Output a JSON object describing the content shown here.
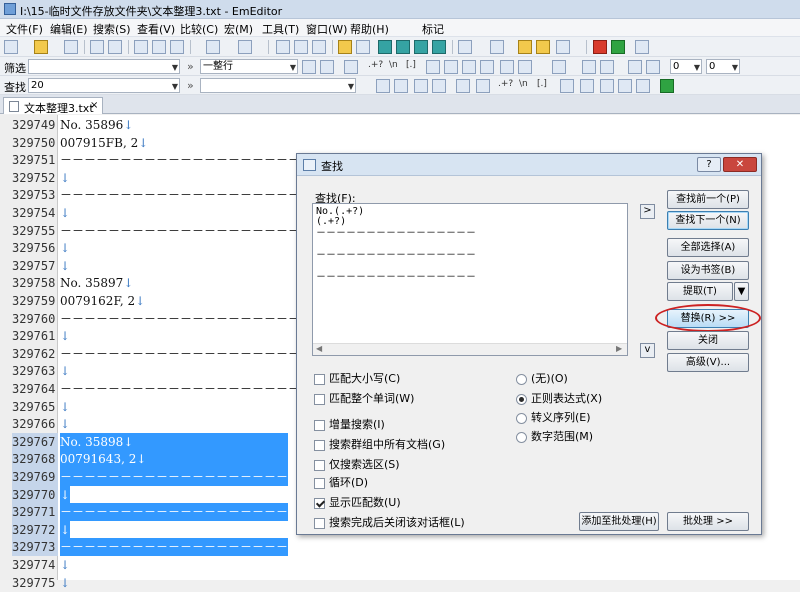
{
  "window": {
    "title": "I:\\15-临时文件存放文件夹\\文本整理3.txt - EmEditor"
  },
  "menu": [
    "文件(F)",
    "编辑(E)",
    "搜索(S)",
    "查看(V)",
    "比较(C)",
    "宏(M)",
    "工具(T)",
    "窗口(W)",
    "帮助(H)",
    "标记"
  ],
  "filter_bar": {
    "label": "筛选",
    "mode_value": "一整行",
    "spin1": "0",
    "spin2": "0",
    "regex_label": ".+?",
    "newline_label": "\\n",
    "bracket_label": "[.]"
  },
  "find_bar": {
    "label": "查找",
    "value": "20",
    "regex_label": ".+?",
    "newline_label": "\\n",
    "bracket_label": "[.]"
  },
  "tab": {
    "label": "文本整理3.txt",
    "close": "×"
  },
  "editor": {
    "line_numbers": [
      "329749",
      "329750",
      "329751",
      "329752",
      "329753",
      "329754",
      "329755",
      "329756",
      "329757",
      "329758",
      "329759",
      "329760",
      "329761",
      "329762",
      "329763",
      "329764",
      "329765",
      "329766",
      "329767",
      "329768",
      "329769",
      "329770",
      "329771",
      "329772",
      "329773",
      "329774",
      "329775"
    ],
    "lines": [
      "No. 35896",
      "007915FB, 2",
      "－－－－－－－－－－－－－－－－－－－－",
      "",
      "－－－－－－－－－－－－－－－－－－－－",
      "",
      "－－－－－－－－－－－－－－－－－－－－",
      "",
      "",
      "No. 35897",
      "0079162F, 2",
      "－－－－－－－－－－－－－－－－－－－－",
      "",
      "－－－－－－－－－－－－－－－－－－－－",
      "",
      "－－－－－－－－－－－－－－－－－－－－",
      "",
      "",
      "No. 35898",
      "00791643, 2",
      "－－－－－－－－－－－－－－－－－－－－",
      "",
      "－－－－－－－－－－－－－－－－－－－－",
      "",
      "－－－－－－－－－－－－－－－－－－－－",
      "",
      ""
    ],
    "newline_mark": "↓"
  },
  "dialog": {
    "title": "查找",
    "help_button": "?",
    "close_button": "✕",
    "find_label": "查找(F):",
    "find_lines": [
      "No.(.+?)",
      "(.+?)",
      "－－－－－－－－－－－－－－－－",
      "",
      "－－－－－－－－－－－－－－－－",
      "",
      "－－－－－－－－－－－－－－－－"
    ],
    "arrow_right": ">",
    "arrow_down": "v",
    "buttons": {
      "find_prev": "查找前一个(P)",
      "find_next": "查找下一个(N)",
      "select_all": "全部选择(A)",
      "bookmark": "设为书签(B)",
      "extract": "提取(T)",
      "extract_arrow": "▼",
      "replace": "替换(R) >>",
      "close": "关闭",
      "advanced": "高级(V)...",
      "add_batch": "添加至批处理(H)",
      "batch": "批处理 >>"
    },
    "checkboxes": [
      {
        "label": "匹配大小写(C)",
        "checked": false
      },
      {
        "label": "匹配整个单词(W)",
        "checked": false
      },
      {
        "label": "增量搜索(I)",
        "checked": false
      },
      {
        "label": "搜索群组中所有文档(G)",
        "checked": false
      },
      {
        "label": "仅搜索选区(S)",
        "checked": false
      },
      {
        "label": "循环(D)",
        "checked": false
      },
      {
        "label": "显示匹配数(U)",
        "checked": true
      },
      {
        "label": "搜索完成后关闭该对话框(L)",
        "checked": false
      }
    ],
    "radios": [
      {
        "label": "(无)(O)",
        "checked": false
      },
      {
        "label": "正则表达式(X)",
        "checked": true
      },
      {
        "label": "转义序列(E)",
        "checked": false
      },
      {
        "label": "数字范围(M)",
        "checked": false
      }
    ]
  }
}
